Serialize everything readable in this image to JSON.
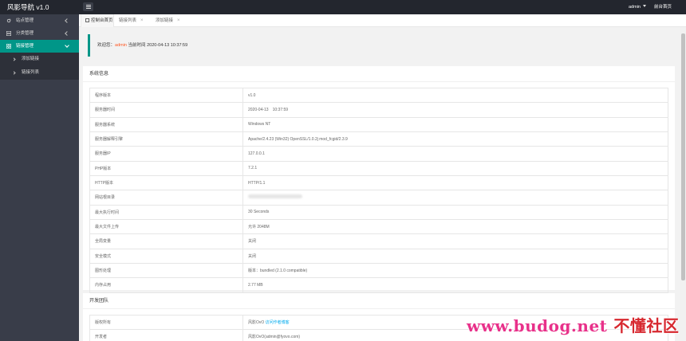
{
  "header": {
    "logo": "风影导航 v1.0",
    "user": "admin",
    "home": "前台首页"
  },
  "sidebar": {
    "items": [
      {
        "label": "站点管理"
      },
      {
        "label": "分类管理"
      },
      {
        "label": "链接管理"
      }
    ],
    "sub_items": [
      {
        "label": "添加链接"
      },
      {
        "label": "链接列表"
      }
    ]
  },
  "tabs": [
    {
      "label": "控制台首页"
    },
    {
      "label": "链接列表"
    },
    {
      "label": "添加链接"
    }
  ],
  "welcome": {
    "prefix": "欢迎您：",
    "user": "admin",
    "time_label": "当前时间",
    "time": "2020-04-13 10:37:59"
  },
  "system": {
    "title": "系统信息",
    "rows": [
      {
        "k": "程序版本",
        "v": "v1.0"
      },
      {
        "k": "服务器时间",
        "v": "2020-04-13　10:37:59"
      },
      {
        "k": "服务器系统",
        "v": "Windows NT"
      },
      {
        "k": "服务器解释引擎",
        "v": "Apache/2.4.23 (Win32) OpenSSL/1.0.2j mod_fcgid/2.3.9"
      },
      {
        "k": "服务器IP",
        "v": "127.0.0.1"
      },
      {
        "k": "PHP版本",
        "v": "7.2.1"
      },
      {
        "k": "HTTP版本",
        "v": "HTTP/1.1"
      },
      {
        "k": "网站根目录",
        "v": ""
      },
      {
        "k": "最大执行时间",
        "v": "30 Seconds"
      },
      {
        "k": "最大文件上传",
        "v": "允许 2048M"
      },
      {
        "k": "全局变量",
        "v": "关闭"
      },
      {
        "k": "安全模式",
        "v": "关闭"
      },
      {
        "k": "图形处理",
        "v": "版本：bundled (2.1.0 compatible)"
      },
      {
        "k": "内存占用",
        "v": "2.77 MB"
      }
    ]
  },
  "team": {
    "title": "开发团队",
    "rows": [
      {
        "k": "版权所有",
        "v": "风影OvO",
        "link": "访问作者博客"
      },
      {
        "k": "开发者",
        "v": "风影OvO(admin@fyovo.com)"
      }
    ]
  },
  "watermark": {
    "url": "www.budog.net",
    "cn": "不懂社区"
  },
  "colors": {
    "accent": "#009688",
    "sidebar": "#393d49",
    "header": "#23262e",
    "user": "#ff5722",
    "link": "#01aaed"
  }
}
